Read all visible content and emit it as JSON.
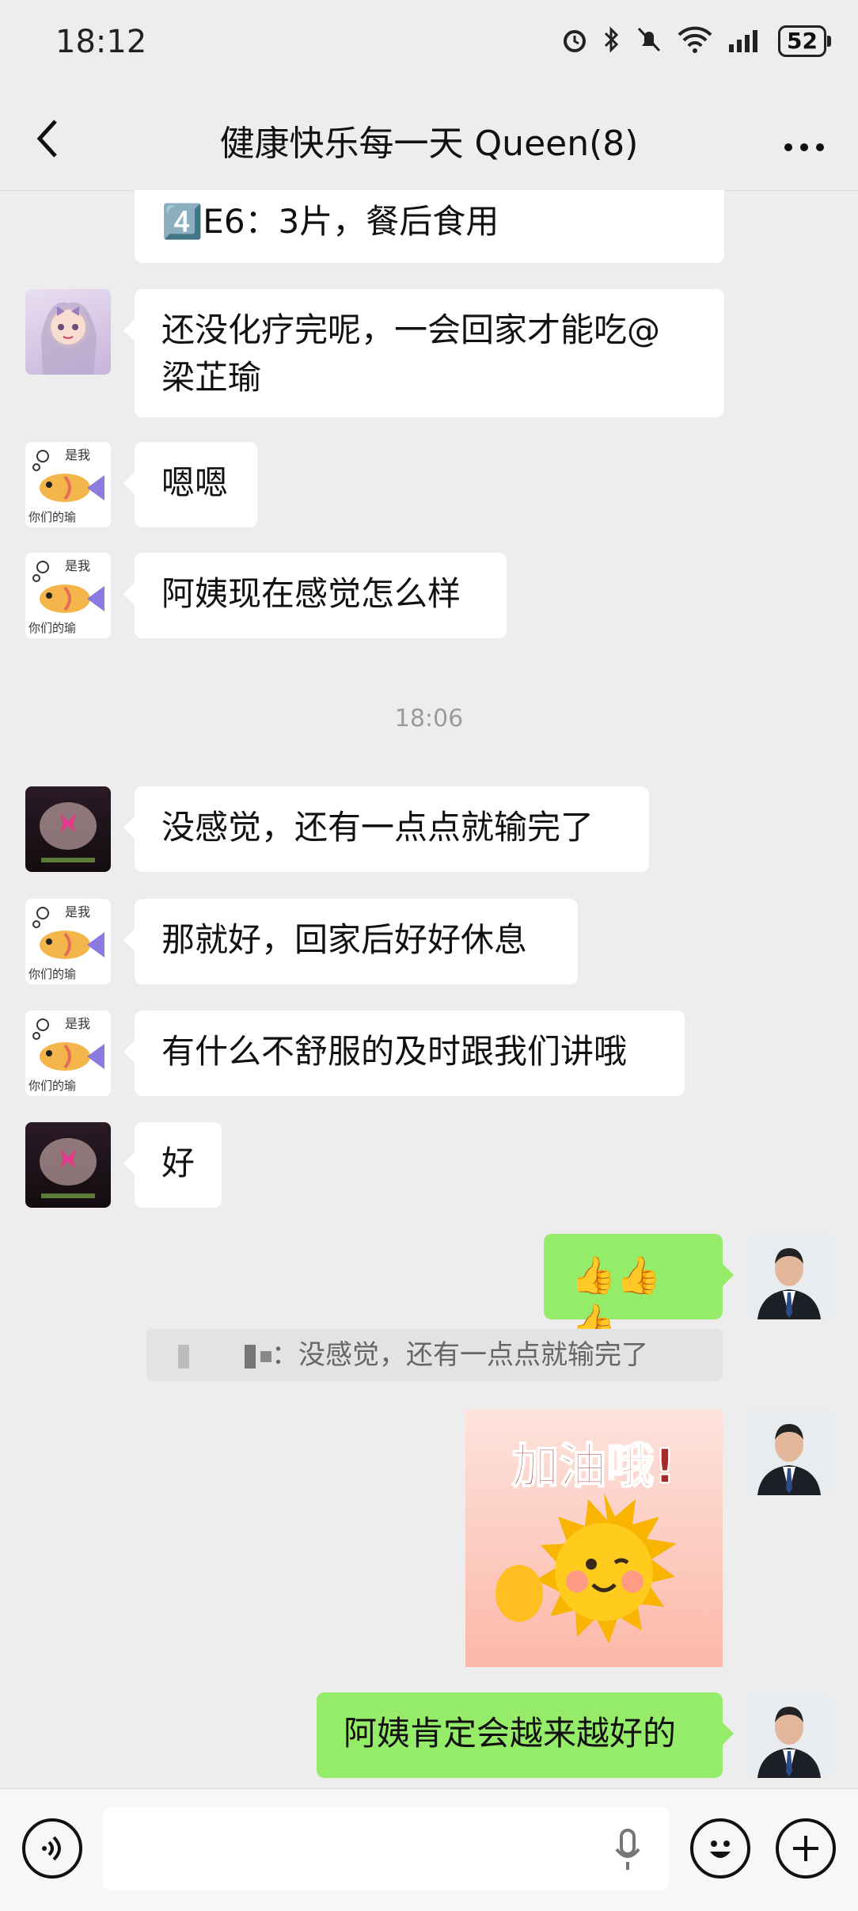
{
  "status_bar": {
    "time": "18:12",
    "battery": "52"
  },
  "header": {
    "title": "健康快乐每一天 Queen(8)"
  },
  "messages": {
    "m0": "4️⃣E6：3片，餐后食用",
    "m1_line1": "还没化疗完呢，一会回家才能吃@",
    "m1_line2": "梁芷瑜",
    "m2": "嗯嗯",
    "m3": "阿姨现在感觉怎么样",
    "timestamp": "18:06",
    "m4": "没感觉，还有一点点就输完了",
    "m5": "那就好，回家后好好休息",
    "m6": "有什么不舒服的及时跟我们讲哦",
    "m7": "好",
    "m8": "👍👍👍",
    "quote": "：没感觉，还有一点点就输完了",
    "sticker_text": "加油哦!",
    "m10": "阿姨肯定会越来越好的"
  },
  "avatar_fish_text": {
    "line1": "是我",
    "line2": "你们的瑜"
  },
  "colors": {
    "bg": "#ededed",
    "bubble_right": "#95ec69",
    "bubble_left": "#ffffff"
  }
}
